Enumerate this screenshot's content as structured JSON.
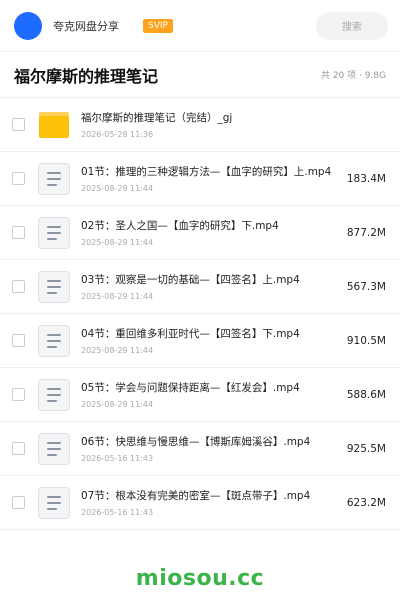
{
  "header": {
    "username": "夸克网盘分享",
    "badge": "SVIP",
    "search_placeholder": "搜索"
  },
  "page": {
    "title": "福尔摩斯的推理笔记",
    "summary": "共 20 项 · 9.8G"
  },
  "files": [
    {
      "type": "folder",
      "name": "福尔摩斯的推理笔记（完结）_gj",
      "date": "2026-05-28 11:36",
      "size": ""
    },
    {
      "type": "file",
      "name": "01节：推理的三种逻辑方法—【血字的研究】上.mp4",
      "date": "2025-08-29 11:44",
      "size": "183.4M"
    },
    {
      "type": "file",
      "name": "02节：圣人之国—【血字的研究】下.mp4",
      "date": "2025-08-29 11:44",
      "size": "877.2M"
    },
    {
      "type": "file",
      "name": "03节：观察是一切的基础—【四签名】上.mp4",
      "date": "2025-08-29 11:44",
      "size": "567.3M"
    },
    {
      "type": "file",
      "name": "04节：重回维多利亚时代—【四签名】下.mp4",
      "date": "2025-08-29 11:44",
      "size": "910.5M"
    },
    {
      "type": "file",
      "name": "05节：学会与问题保持距离—【红发会】.mp4",
      "date": "2025-08-29 11:44",
      "size": "588.6M"
    },
    {
      "type": "file",
      "name": "06节：快思维与慢思维—【博斯库姆溪谷】.mp4",
      "date": "2026-05-16 11:43",
      "size": "925.5M"
    },
    {
      "type": "file",
      "name": "07节：根本没有完美的密室—【斑点带子】.mp4",
      "date": "2026-05-16 11:43",
      "size": "623.2M"
    }
  ],
  "watermark": "miosou.cc",
  "colors": {
    "avatar": "#1e6bff",
    "svip_badge": "#ffa21e",
    "folder": "#ffc107",
    "watermark": "#3bb54a"
  }
}
